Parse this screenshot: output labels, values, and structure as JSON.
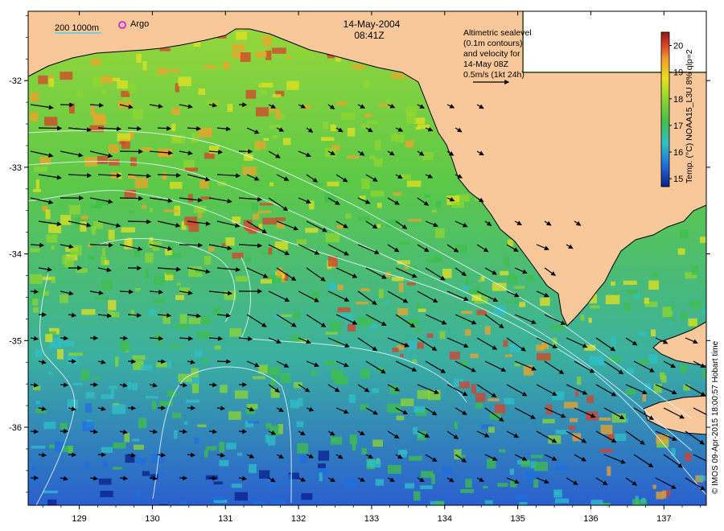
{
  "header": {
    "date": "14-May-2004",
    "time": "08:41Z"
  },
  "legend": {
    "bathymetry_label": "200 1000m",
    "argo_label": "Argo",
    "altimetry_lines": [
      "Altimetric sealevel",
      "(0.1m contours)",
      "and velocity for",
      "14-May 08Z",
      "0.5m/s (1kt 24h)"
    ]
  },
  "colorbar": {
    "title": "Temp. (°C) NOAA15_L3U 8% qlp=2",
    "ticks": [
      "15",
      "16",
      "17",
      "18",
      "19",
      "20"
    ],
    "min": 14.7,
    "max": 20.5
  },
  "credit": "© IMOS 09-Apr-2015 18:00:57 Hobart time",
  "axes": {
    "x_ticks": [
      "129",
      "130",
      "131",
      "132",
      "133",
      "134",
      "135",
      "136",
      "137"
    ],
    "y_ticks": [
      "-32",
      "-33",
      "-34",
      "-35",
      "-36"
    ],
    "x_range": [
      128.3,
      137.58
    ],
    "y_range": [
      -36.9,
      -31.2
    ]
  },
  "colors": {
    "land": "#f8c89b",
    "sea_gradient": [
      "#0a1f8c",
      "#1e6fe0",
      "#2fc0c8",
      "#3fbf4a",
      "#8fd630",
      "#e6e020",
      "#f2a12a",
      "#d8402a",
      "#8b1a10"
    ],
    "contour": "#e6f5ff",
    "arrow": "#000000",
    "argo_marker": "#e020e0",
    "bathy_line": "#7ad0d0"
  }
}
